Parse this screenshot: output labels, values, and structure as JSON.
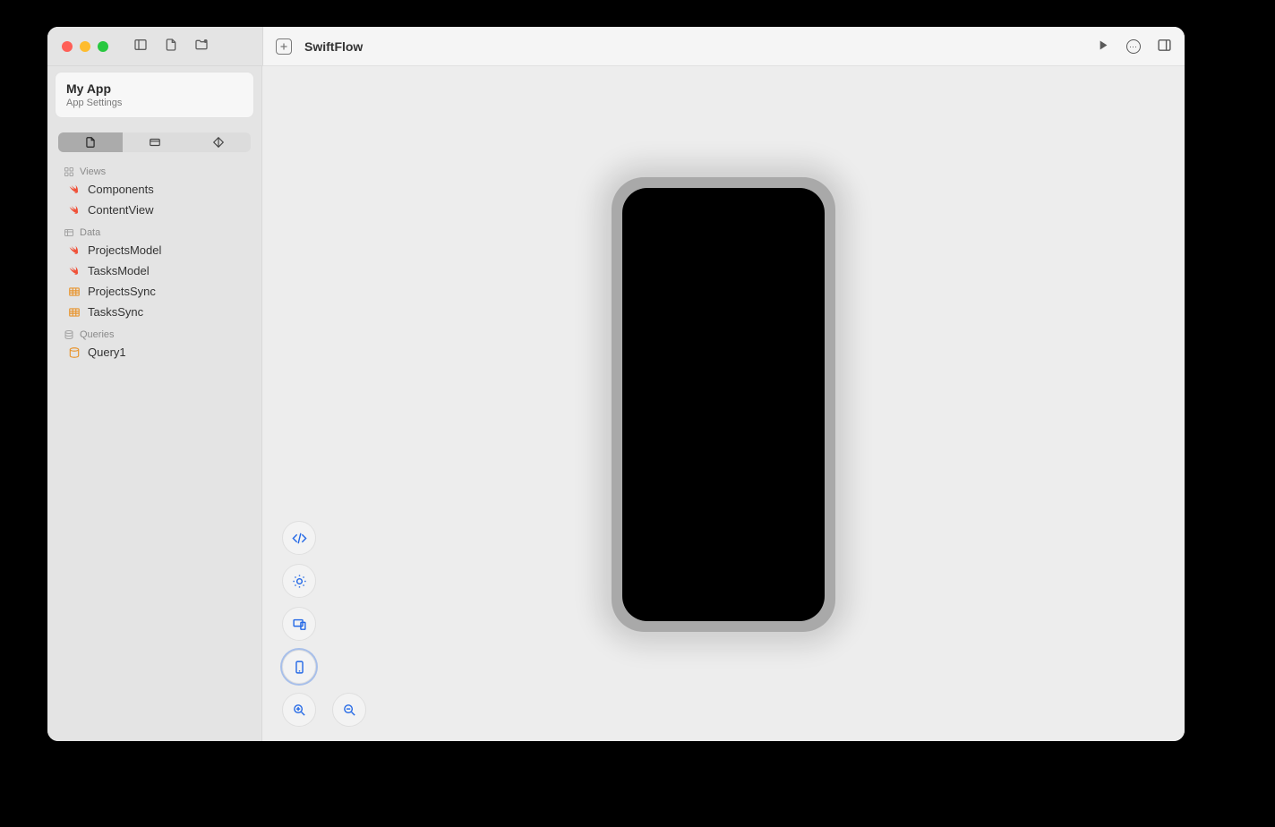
{
  "header": {
    "title": "SwiftFlow"
  },
  "sidebar": {
    "app_name": "My App",
    "app_subtitle": "App Settings",
    "sections": {
      "views": {
        "label": "Views",
        "items": [
          {
            "label": "Components",
            "type": "swift"
          },
          {
            "label": "ContentView",
            "type": "swift"
          }
        ]
      },
      "data": {
        "label": "Data",
        "items": [
          {
            "label": "ProjectsModel",
            "type": "swift"
          },
          {
            "label": "TasksModel",
            "type": "swift"
          },
          {
            "label": "ProjectsSync",
            "type": "table"
          },
          {
            "label": "TasksSync",
            "type": "table"
          }
        ]
      },
      "queries": {
        "label": "Queries",
        "items": [
          {
            "label": "Query1",
            "type": "query"
          }
        ]
      }
    }
  }
}
